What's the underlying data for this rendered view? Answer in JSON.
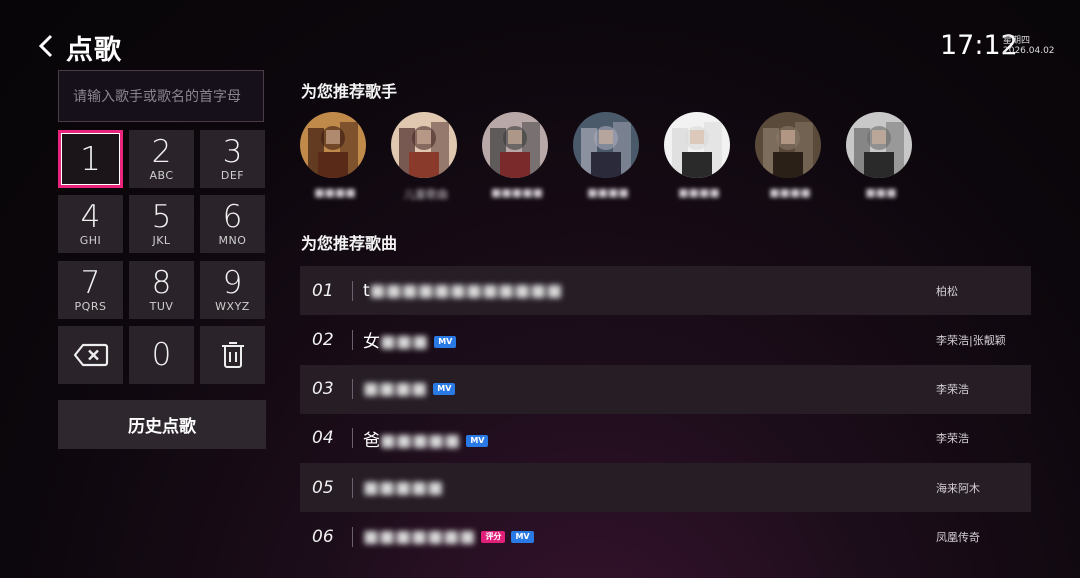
{
  "header": {
    "title": "点歌",
    "time": "17:12",
    "weekday": "星期四",
    "date": "2026.04.02"
  },
  "search": {
    "placeholder": "请输入歌手或歌名的首字母"
  },
  "keypad": {
    "keys": [
      {
        "num": "1",
        "letters": ""
      },
      {
        "num": "2",
        "letters": "ABC"
      },
      {
        "num": "3",
        "letters": "DEF"
      },
      {
        "num": "4",
        "letters": "GHI"
      },
      {
        "num": "5",
        "letters": "JKL"
      },
      {
        "num": "6",
        "letters": "MNO"
      },
      {
        "num": "7",
        "letters": "PQRS"
      },
      {
        "num": "8",
        "letters": "TUV"
      },
      {
        "num": "9",
        "letters": "WXYZ"
      }
    ],
    "zero": "0",
    "backspace_icon": "backspace-icon",
    "delete_icon": "trash-icon"
  },
  "history_button": "历史点歌",
  "singers": {
    "title": "为您推荐歌手",
    "items": [
      {
        "name": "■■■■",
        "colors": [
          "#c08a4a",
          "#5a2a18",
          "#3a1a10"
        ]
      },
      {
        "name": "儿童歌曲",
        "colors": [
          "#e0c8b0",
          "#8a3a2a",
          "#4a2a2a"
        ]
      },
      {
        "name": "■■■■■",
        "colors": [
          "#b8a8a8",
          "#7a2a2a",
          "#3a3a3a"
        ]
      },
      {
        "name": "■■■■",
        "colors": [
          "#4a5a6a",
          "#2a2a3a",
          "#a8a8b8"
        ]
      },
      {
        "name": "■■■■",
        "colors": [
          "#f2f2f2",
          "#2a2a2a",
          "#d8d8d8"
        ]
      },
      {
        "name": "■■■■",
        "colors": [
          "#5a4a3a",
          "#2a2018",
          "#8a7a6a"
        ]
      },
      {
        "name": "■■■",
        "colors": [
          "#c8c8c8",
          "#2a2a2a",
          "#6a6a6a"
        ]
      }
    ]
  },
  "songs": {
    "title": "为您推荐歌曲",
    "items": [
      {
        "index": "01",
        "first": "t",
        "rest": "■■■■■■■■■■■■",
        "badges": [],
        "artist": "柏松"
      },
      {
        "index": "02",
        "first": "女",
        "rest": "■■■",
        "badges": [
          "MV"
        ],
        "artist": "李荣浩|张靓颖"
      },
      {
        "index": "03",
        "first": "",
        "rest": "■■■■",
        "badges": [
          "MV"
        ],
        "artist": "李荣浩"
      },
      {
        "index": "04",
        "first": "爸",
        "rest": "■■■■■",
        "badges": [
          "MV"
        ],
        "artist": "李荣浩"
      },
      {
        "index": "05",
        "first": "",
        "rest": "■■■■■",
        "badges": [],
        "artist": "海来阿木"
      },
      {
        "index": "06",
        "first": "",
        "rest": "■■■■■■■",
        "badges": [
          "评分",
          "MV"
        ],
        "artist": "凤凰传奇"
      }
    ]
  },
  "colors": {
    "focus_border": "#e8247d",
    "mv_badge": "#2a7ae6",
    "score_badge": "#e0207a"
  }
}
